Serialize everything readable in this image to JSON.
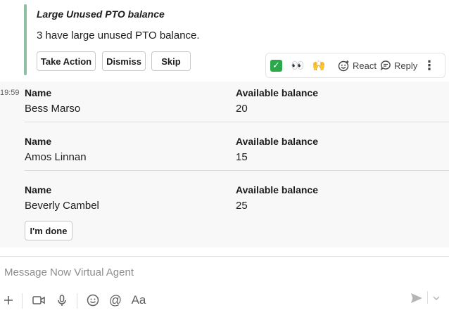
{
  "attachment": {
    "title": "Large Unused PTO balance",
    "body": "3 have large unused PTO balance.",
    "buttons": {
      "take_action": "Take Action",
      "dismiss": "Dismiss",
      "skip": "Skip"
    }
  },
  "toolbar": {
    "emoji_1": "✅",
    "emoji_2": "👀",
    "emoji_3": "🙌",
    "react_label": "React",
    "reply_label": "Reply",
    "more_label": "⋮"
  },
  "message": {
    "timestamp": "19:59",
    "rows": [
      {
        "name_label": "Name",
        "name": "Bess Marso",
        "balance_label": "Available balance",
        "balance": "20"
      },
      {
        "name_label": "Name",
        "name": "Amos Linnan",
        "balance_label": "Available balance",
        "balance": "15"
      },
      {
        "name_label": "Name",
        "name": "Beverly Cambel",
        "balance_label": "Available balance",
        "balance": "25"
      }
    ],
    "done_label": "I'm done"
  },
  "composer": {
    "placeholder": "Message Now Virtual Agent",
    "format_label": "Aa"
  },
  "colors": {
    "accent_bar": "#8fbfa3",
    "check_bg": "#2aa84a"
  }
}
